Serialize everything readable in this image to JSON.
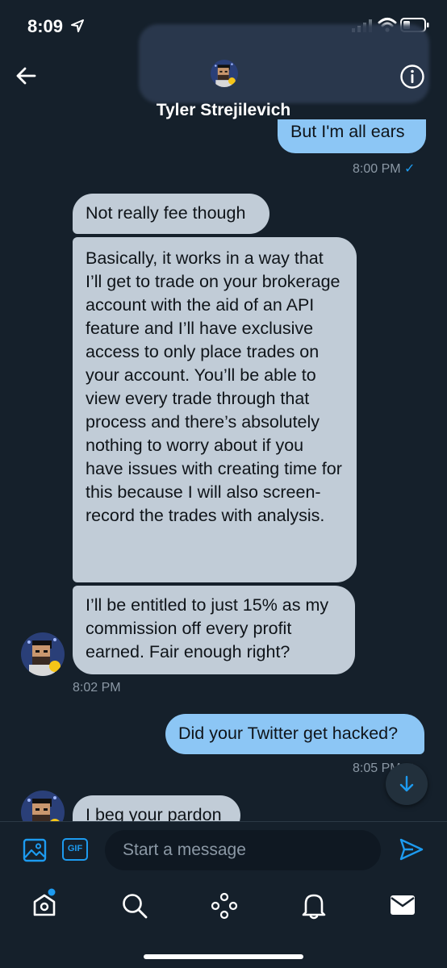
{
  "status_bar": {
    "time": "8:09"
  },
  "header": {
    "contact_name": "Tyler Strejilevich"
  },
  "messages": [
    {
      "dir": "out",
      "text": "But I'm all ears",
      "time": "8:00 PM"
    },
    {
      "dir": "in",
      "text": "Not really fee though"
    },
    {
      "dir": "in",
      "text": "Basically, it works in a way that I’ll get to trade on your brokerage account with the aid of an API feature and I’ll have exclusive access to only place trades on your account. You’ll be able to view every trade through that process and there’s absolutely nothing to worry about if you have issues with creating time for this because I will also screen-record the trades with analysis."
    },
    {
      "dir": "in",
      "text": "I’ll  be entitled to just 15% as my commission off every profit earned. Fair enough right?",
      "time": "8:02 PM"
    },
    {
      "dir": "out",
      "text": "Did your Twitter get hacked?",
      "time": "8:05 PM"
    },
    {
      "dir": "in",
      "text": "I beg your pardon"
    }
  ],
  "composer": {
    "placeholder": "Start a message",
    "gif_label": "GIF"
  },
  "colors": {
    "background": "#15202b",
    "accent": "#1d9bf0",
    "incoming": "#c1ccd7",
    "outgoing": "#8cc6f5"
  }
}
